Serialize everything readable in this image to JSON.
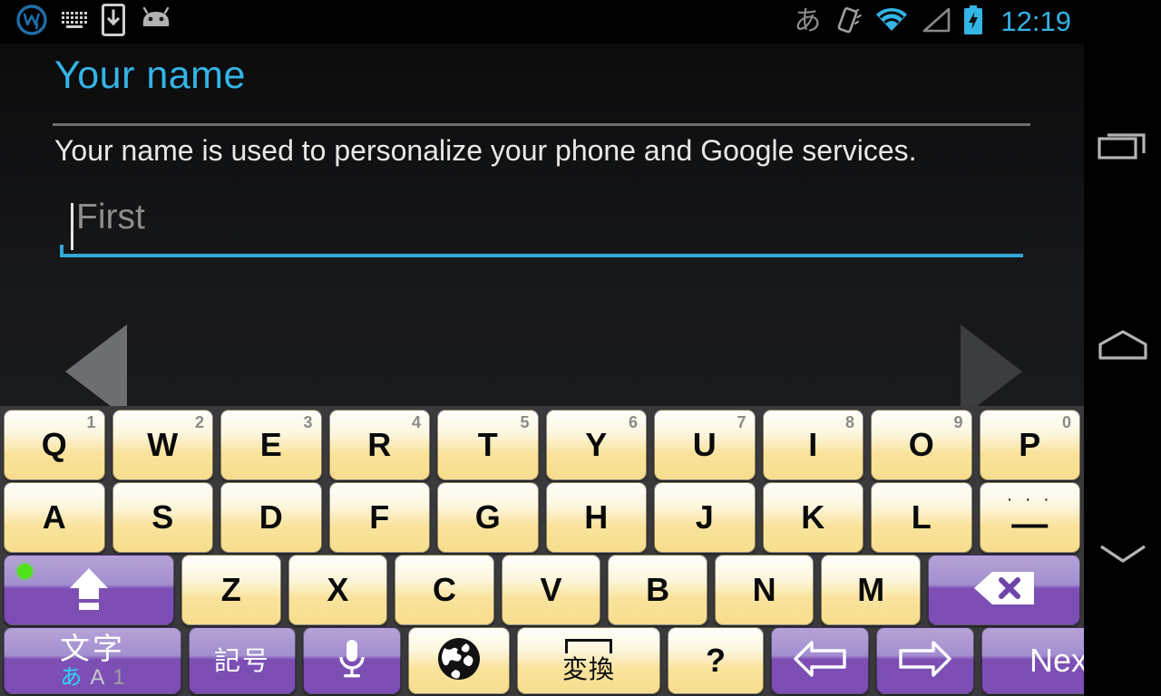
{
  "statusbar": {
    "left_icons": [
      "wikipedia-w-logo-icon",
      "keyboard-icon",
      "download-to-phone-icon",
      "android-head-icon"
    ],
    "ime_indicator": "あ",
    "right_icons": [
      "vibrate-icon",
      "wifi-icon",
      "cellular-signal-icon",
      "battery-charging-icon"
    ],
    "time": "12:19"
  },
  "content": {
    "title": "Your name",
    "description": "Your name is used to personalize your phone and Google services.",
    "input": {
      "value": "",
      "placeholder": "First"
    },
    "nav_prev": "back-triangle",
    "nav_next": "forward-triangle"
  },
  "keyboard": {
    "row1": [
      {
        "label": "Q",
        "sub": "1"
      },
      {
        "label": "W",
        "sub": "2"
      },
      {
        "label": "E",
        "sub": "3"
      },
      {
        "label": "R",
        "sub": "4"
      },
      {
        "label": "T",
        "sub": "5"
      },
      {
        "label": "Y",
        "sub": "6"
      },
      {
        "label": "U",
        "sub": "7"
      },
      {
        "label": "I",
        "sub": "8"
      },
      {
        "label": "O",
        "sub": "9"
      },
      {
        "label": "P",
        "sub": "0"
      }
    ],
    "row2": [
      {
        "label": "A"
      },
      {
        "label": "S"
      },
      {
        "label": "D"
      },
      {
        "label": "F"
      },
      {
        "label": "G"
      },
      {
        "label": "H"
      },
      {
        "label": "J"
      },
      {
        "label": "K"
      },
      {
        "label": "L"
      }
    ],
    "row2_last": {
      "dots": "· · ·",
      "label": "—"
    },
    "row3": [
      {
        "label": "Z"
      },
      {
        "label": "X"
      },
      {
        "label": "C"
      },
      {
        "label": "V"
      },
      {
        "label": "B"
      },
      {
        "label": "N"
      },
      {
        "label": "M"
      }
    ],
    "shift": {
      "name": "shift-key",
      "led": "on"
    },
    "backspace": {
      "name": "backspace-key"
    },
    "row4": {
      "moji": {
        "main": "文字",
        "a": "あ",
        "A": "A",
        "one": "1"
      },
      "kigou": "記号",
      "mic": "microphone-key",
      "globe": "globe-language-key",
      "space": "変換",
      "question": "?",
      "arrow_left": "arrow-left-key",
      "arrow_right": "arrow-right-key",
      "next": "Next"
    }
  },
  "navbar": {
    "recents": "recents-icon",
    "home": "home-icon",
    "down": "hide-keyboard-chevron-icon"
  },
  "colors": {
    "accent_blue": "#33b5e5",
    "key_cream": "#f9e39c",
    "key_purple": "#7d4fb5",
    "led_green": "#4fe21a"
  }
}
